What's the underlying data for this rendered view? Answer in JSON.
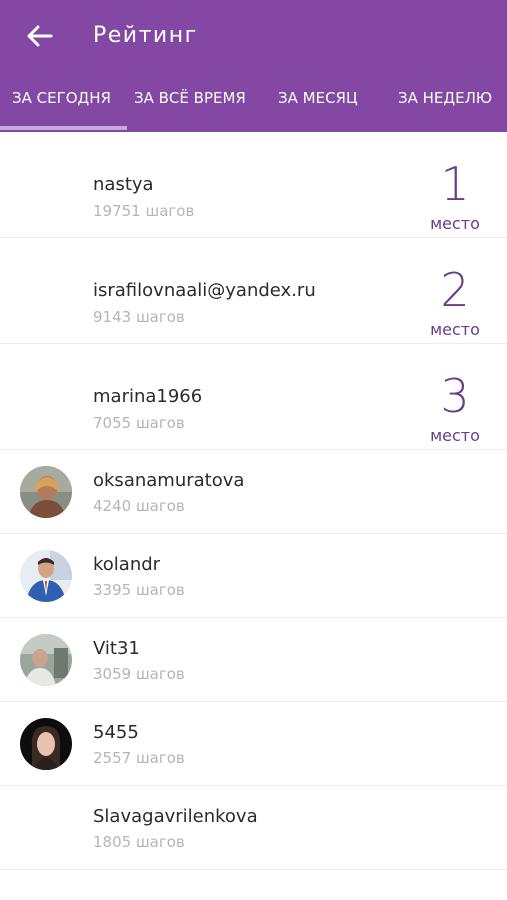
{
  "header": {
    "title": "Рейтинг",
    "bg_color": "#8347a4",
    "back_icon": "arrow-left-icon"
  },
  "tabs": [
    {
      "label": "ЗА СЕГОДНЯ",
      "active": true
    },
    {
      "label": "ЗА ВСЁ ВРЕМЯ",
      "active": false
    },
    {
      "label": "ЗА МЕСЯЦ",
      "active": false
    },
    {
      "label": "ЗА НЕДЕЛЮ",
      "active": false
    }
  ],
  "accent_color": "#6a3d86",
  "top_entries": [
    {
      "name": "nastya",
      "steps": "19751 шагов",
      "place": "1",
      "place_label": "место"
    },
    {
      "name": "israfilovnaali@yandex.ru",
      "steps": "9143 шагов",
      "place": "2",
      "place_label": "место"
    },
    {
      "name": "marina1966",
      "steps": "7055 шагов",
      "place": "3",
      "place_label": "место"
    }
  ],
  "entries": [
    {
      "name": "oksanamuratova",
      "steps": "4240 шагов",
      "avatar": "user-photo"
    },
    {
      "name": "kolandr",
      "steps": "3395 шагов",
      "avatar": "user-photo"
    },
    {
      "name": "Vit31",
      "steps": "3059 шагов",
      "avatar": "user-photo"
    },
    {
      "name": "5455",
      "steps": "2557 шагов",
      "avatar": "user-photo"
    },
    {
      "name": "Slavagavrilenkova",
      "steps": "1805 шагов",
      "avatar": "none"
    }
  ]
}
